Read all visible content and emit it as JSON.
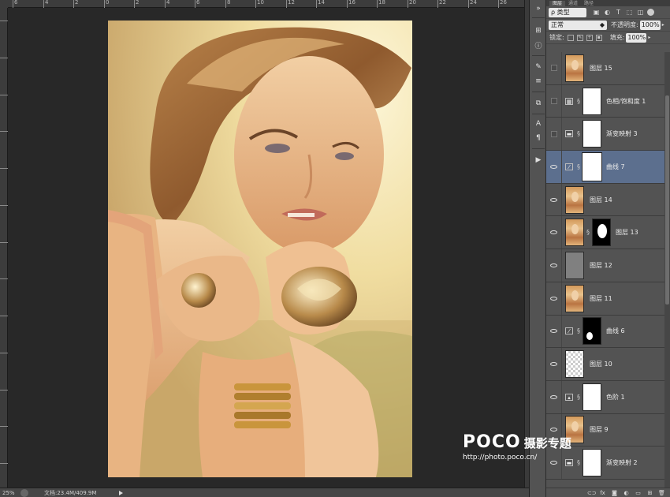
{
  "ruler": {
    "top_labels": [
      "6",
      "4",
      "2",
      "0",
      "2",
      "4",
      "6",
      "8",
      "10",
      "12",
      "14",
      "16",
      "18",
      "20",
      "22",
      "24",
      "26"
    ],
    "left_labels": [
      "0",
      "2",
      "4",
      "6",
      "8",
      "10",
      "12",
      "14",
      "16",
      "18",
      "20",
      "22",
      "24"
    ]
  },
  "status": {
    "zoom": "25%",
    "doc_info": "文档:23.4M/409.9M"
  },
  "panel": {
    "tabs": [
      "图层",
      "通道",
      "路径"
    ],
    "filter_label": "ρ 类型",
    "blend_mode": "正常",
    "opacity_label": "不透明度:",
    "opacity_value": "100%",
    "lock_label": "锁定:",
    "fill_label": "填充:",
    "fill_value": "100%"
  },
  "layers": [
    {
      "name": "图层 15",
      "kind": "pixel",
      "visible": false,
      "thumb": "photo"
    },
    {
      "name": "色相/饱和度 1",
      "kind": "adjustment",
      "visible": false,
      "icon": "hue-sat-icon",
      "mask": "white"
    },
    {
      "name": "渐变映射 3",
      "kind": "adjustment",
      "visible": false,
      "icon": "gradient-map-icon",
      "mask": "white"
    },
    {
      "name": "曲线 7",
      "kind": "adjustment",
      "visible": true,
      "icon": "curves-icon",
      "mask": "white",
      "selected": true
    },
    {
      "name": "图层 14",
      "kind": "pixel",
      "visible": true,
      "thumb": "photo"
    },
    {
      "name": "图层 13",
      "kind": "pixel-mask",
      "visible": true,
      "thumb": "photo",
      "mask": "black-figure"
    },
    {
      "name": "图层 12",
      "kind": "pixel",
      "visible": true,
      "thumb": "gray"
    },
    {
      "name": "图层 11",
      "kind": "pixel",
      "visible": true,
      "thumb": "photo"
    },
    {
      "name": "曲线 6",
      "kind": "adjustment",
      "visible": true,
      "icon": "curves-icon",
      "mask": "black-spot"
    },
    {
      "name": "图层 10",
      "kind": "pixel",
      "visible": true,
      "thumb": "checker"
    },
    {
      "name": "色阶 1",
      "kind": "adjustment",
      "visible": true,
      "icon": "levels-icon",
      "mask": "white"
    },
    {
      "name": "图层 9",
      "kind": "pixel",
      "visible": true,
      "thumb": "photo"
    },
    {
      "name": "渐变映射 2",
      "kind": "adjustment",
      "visible": true,
      "icon": "gradient-map-icon",
      "mask": "white"
    }
  ],
  "watermark": {
    "logo": "POCO",
    "sub": "摄影专题",
    "url": "http://photo.poco.cn/"
  },
  "colors": {
    "selected_layer": "#5c6f8e",
    "panel_bg": "#535353",
    "canvas_bg": "#282828"
  }
}
